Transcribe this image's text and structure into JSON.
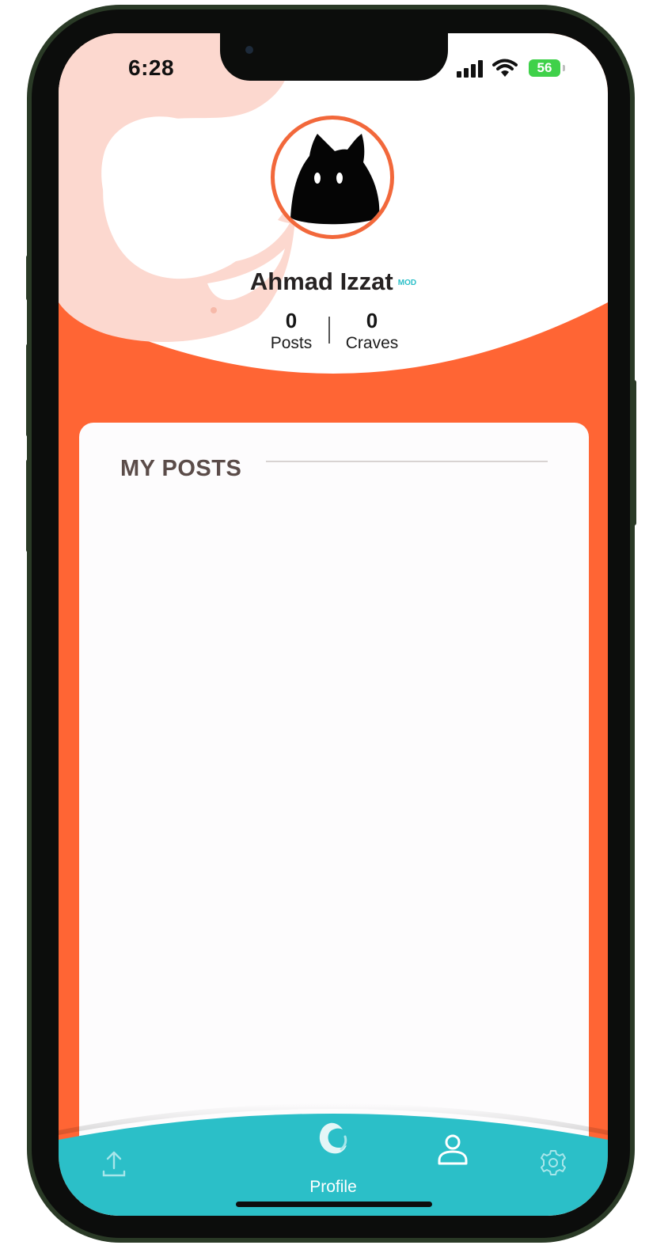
{
  "status_bar": {
    "time": "6:28",
    "battery": "56"
  },
  "profile": {
    "name": "Ahmad Izzat",
    "badge": "MOD",
    "stats": {
      "posts_value": "0",
      "posts_label": "Posts",
      "craves_value": "0",
      "craves_label": "Craves"
    }
  },
  "posts_section": {
    "title": "MY POSTS"
  },
  "bottom_nav": {
    "items": [
      {
        "icon": "upload-icon"
      },
      {
        "icon": "app-logo-icon",
        "label": "Profile"
      },
      {
        "icon": "profile-icon"
      },
      {
        "icon": "settings-gear-icon"
      }
    ],
    "active_label": "Profile"
  },
  "colors": {
    "accent_orange": "#ff6534",
    "nav_teal": "#2bbfc8",
    "card_white": "#fdfcfd",
    "battery_green": "#3fd14a"
  }
}
